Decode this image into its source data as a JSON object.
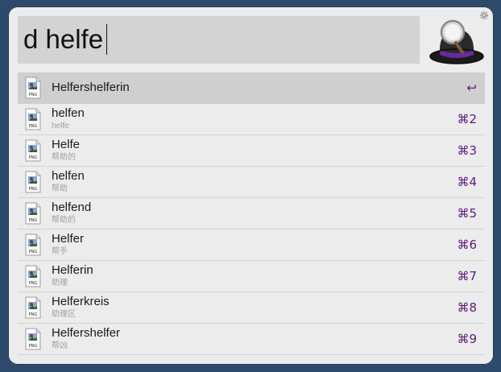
{
  "search": {
    "query": "d helfe"
  },
  "results": [
    {
      "title": "Helfershelferin",
      "subtitle": "",
      "shortcut": "↩",
      "selected": true
    },
    {
      "title": "helfen",
      "subtitle": "helfe",
      "shortcut": "⌘2"
    },
    {
      "title": "Helfe",
      "subtitle": "帮助的",
      "shortcut": "⌘3"
    },
    {
      "title": "helfen",
      "subtitle": "帮助",
      "shortcut": "⌘4"
    },
    {
      "title": "helfend",
      "subtitle": "帮助的",
      "shortcut": "⌘5"
    },
    {
      "title": "Helfer",
      "subtitle": "帮手",
      "shortcut": "⌘6"
    },
    {
      "title": "Helferin",
      "subtitle": "助理",
      "shortcut": "⌘7"
    },
    {
      "title": "Helferkreis",
      "subtitle": "助理区",
      "shortcut": "⌘8"
    },
    {
      "title": "Helfershelfer",
      "subtitle": "帮凶",
      "shortcut": "⌘9"
    }
  ],
  "icons": {
    "settings": "gear-icon",
    "app_logo": "alfred-hat-icon",
    "result": "png-file-icon"
  },
  "colors": {
    "accent": "#5c1a7a",
    "selected_row": "#cfcfcf",
    "search_bg": "#d3d3d3"
  }
}
